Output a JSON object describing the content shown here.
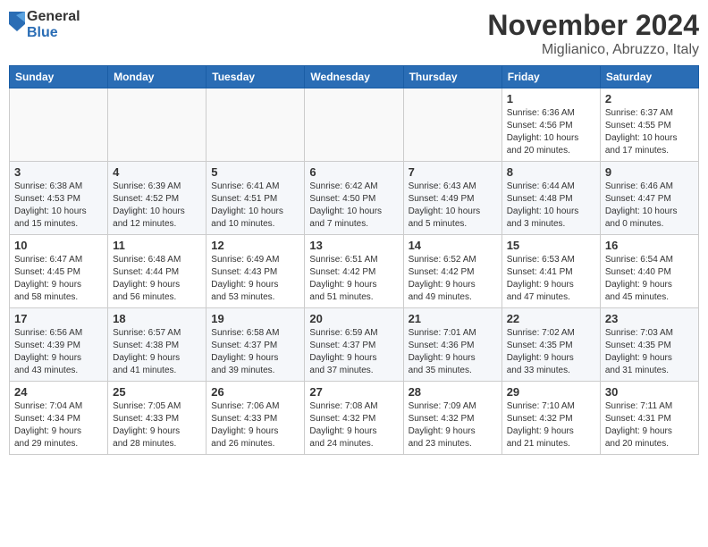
{
  "header": {
    "logo_general": "General",
    "logo_blue": "Blue",
    "month_year": "November 2024",
    "location": "Miglianico, Abruzzo, Italy"
  },
  "weekdays": [
    "Sunday",
    "Monday",
    "Tuesday",
    "Wednesday",
    "Thursday",
    "Friday",
    "Saturday"
  ],
  "weeks": [
    [
      {
        "day": "",
        "content": ""
      },
      {
        "day": "",
        "content": ""
      },
      {
        "day": "",
        "content": ""
      },
      {
        "day": "",
        "content": ""
      },
      {
        "day": "",
        "content": ""
      },
      {
        "day": "1",
        "content": "Sunrise: 6:36 AM\nSunset: 4:56 PM\nDaylight: 10 hours\nand 20 minutes."
      },
      {
        "day": "2",
        "content": "Sunrise: 6:37 AM\nSunset: 4:55 PM\nDaylight: 10 hours\nand 17 minutes."
      }
    ],
    [
      {
        "day": "3",
        "content": "Sunrise: 6:38 AM\nSunset: 4:53 PM\nDaylight: 10 hours\nand 15 minutes."
      },
      {
        "day": "4",
        "content": "Sunrise: 6:39 AM\nSunset: 4:52 PM\nDaylight: 10 hours\nand 12 minutes."
      },
      {
        "day": "5",
        "content": "Sunrise: 6:41 AM\nSunset: 4:51 PM\nDaylight: 10 hours\nand 10 minutes."
      },
      {
        "day": "6",
        "content": "Sunrise: 6:42 AM\nSunset: 4:50 PM\nDaylight: 10 hours\nand 7 minutes."
      },
      {
        "day": "7",
        "content": "Sunrise: 6:43 AM\nSunset: 4:49 PM\nDaylight: 10 hours\nand 5 minutes."
      },
      {
        "day": "8",
        "content": "Sunrise: 6:44 AM\nSunset: 4:48 PM\nDaylight: 10 hours\nand 3 minutes."
      },
      {
        "day": "9",
        "content": "Sunrise: 6:46 AM\nSunset: 4:47 PM\nDaylight: 10 hours\nand 0 minutes."
      }
    ],
    [
      {
        "day": "10",
        "content": "Sunrise: 6:47 AM\nSunset: 4:45 PM\nDaylight: 9 hours\nand 58 minutes."
      },
      {
        "day": "11",
        "content": "Sunrise: 6:48 AM\nSunset: 4:44 PM\nDaylight: 9 hours\nand 56 minutes."
      },
      {
        "day": "12",
        "content": "Sunrise: 6:49 AM\nSunset: 4:43 PM\nDaylight: 9 hours\nand 53 minutes."
      },
      {
        "day": "13",
        "content": "Sunrise: 6:51 AM\nSunset: 4:42 PM\nDaylight: 9 hours\nand 51 minutes."
      },
      {
        "day": "14",
        "content": "Sunrise: 6:52 AM\nSunset: 4:42 PM\nDaylight: 9 hours\nand 49 minutes."
      },
      {
        "day": "15",
        "content": "Sunrise: 6:53 AM\nSunset: 4:41 PM\nDaylight: 9 hours\nand 47 minutes."
      },
      {
        "day": "16",
        "content": "Sunrise: 6:54 AM\nSunset: 4:40 PM\nDaylight: 9 hours\nand 45 minutes."
      }
    ],
    [
      {
        "day": "17",
        "content": "Sunrise: 6:56 AM\nSunset: 4:39 PM\nDaylight: 9 hours\nand 43 minutes."
      },
      {
        "day": "18",
        "content": "Sunrise: 6:57 AM\nSunset: 4:38 PM\nDaylight: 9 hours\nand 41 minutes."
      },
      {
        "day": "19",
        "content": "Sunrise: 6:58 AM\nSunset: 4:37 PM\nDaylight: 9 hours\nand 39 minutes."
      },
      {
        "day": "20",
        "content": "Sunrise: 6:59 AM\nSunset: 4:37 PM\nDaylight: 9 hours\nand 37 minutes."
      },
      {
        "day": "21",
        "content": "Sunrise: 7:01 AM\nSunset: 4:36 PM\nDaylight: 9 hours\nand 35 minutes."
      },
      {
        "day": "22",
        "content": "Sunrise: 7:02 AM\nSunset: 4:35 PM\nDaylight: 9 hours\nand 33 minutes."
      },
      {
        "day": "23",
        "content": "Sunrise: 7:03 AM\nSunset: 4:35 PM\nDaylight: 9 hours\nand 31 minutes."
      }
    ],
    [
      {
        "day": "24",
        "content": "Sunrise: 7:04 AM\nSunset: 4:34 PM\nDaylight: 9 hours\nand 29 minutes."
      },
      {
        "day": "25",
        "content": "Sunrise: 7:05 AM\nSunset: 4:33 PM\nDaylight: 9 hours\nand 28 minutes."
      },
      {
        "day": "26",
        "content": "Sunrise: 7:06 AM\nSunset: 4:33 PM\nDaylight: 9 hours\nand 26 minutes."
      },
      {
        "day": "27",
        "content": "Sunrise: 7:08 AM\nSunset: 4:32 PM\nDaylight: 9 hours\nand 24 minutes."
      },
      {
        "day": "28",
        "content": "Sunrise: 7:09 AM\nSunset: 4:32 PM\nDaylight: 9 hours\nand 23 minutes."
      },
      {
        "day": "29",
        "content": "Sunrise: 7:10 AM\nSunset: 4:32 PM\nDaylight: 9 hours\nand 21 minutes."
      },
      {
        "day": "30",
        "content": "Sunrise: 7:11 AM\nSunset: 4:31 PM\nDaylight: 9 hours\nand 20 minutes."
      }
    ]
  ]
}
